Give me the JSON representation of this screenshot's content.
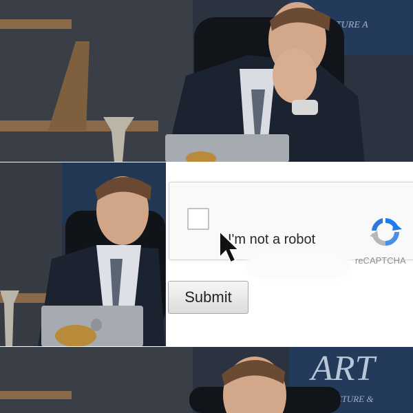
{
  "captcha": {
    "checkbox_label": "I'm not a robot",
    "brand_text": "reCAPTCHA",
    "checked": false
  },
  "form": {
    "submit_label": "Submit"
  },
  "background_sign": {
    "top_text": "ECTURE A",
    "bottom_big": "ART",
    "bottom_text": "ECTURE &"
  },
  "colors": {
    "recaptcha_blue": "#1c7ced",
    "recaptcha_gray": "#b7b7b7",
    "office_wall": "#2b3442"
  }
}
